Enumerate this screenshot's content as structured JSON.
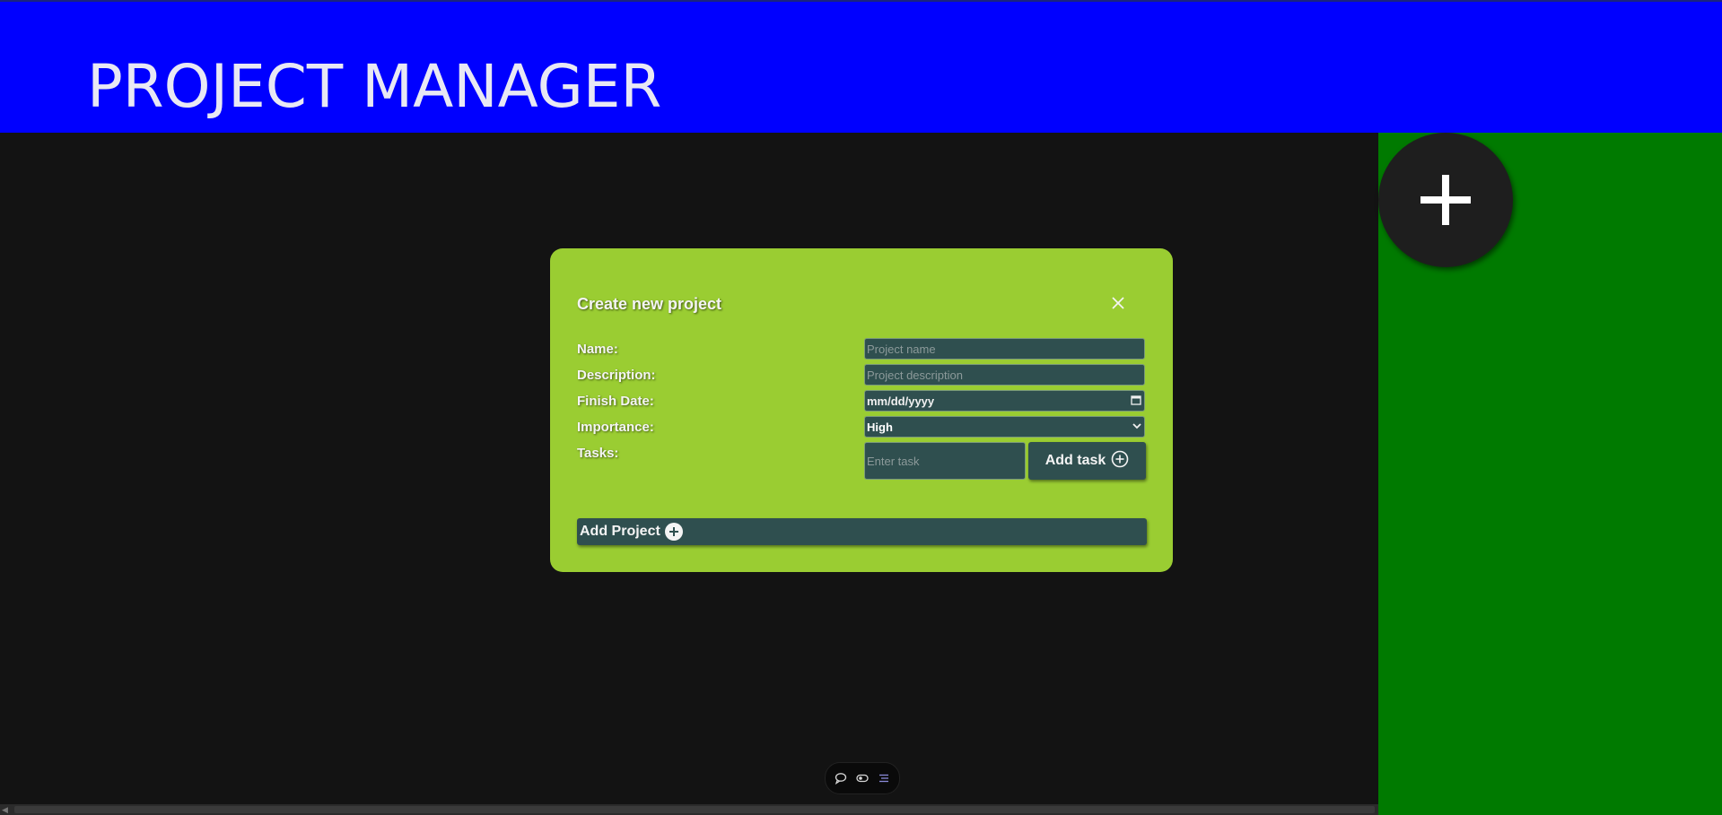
{
  "header": {
    "title": "PROJECT MANAGER"
  },
  "colors": {
    "header_bg": "#0000ff",
    "main_bg": "#131313",
    "sidebar_bg": "#007a00",
    "modal_bg": "#9acd32",
    "field_bg": "#2f4f4f"
  },
  "sidebar": {
    "add_button_icon": "plus-icon"
  },
  "modal": {
    "title": "Create new project",
    "close_icon": "close-icon",
    "fields": {
      "name": {
        "label": "Name:",
        "placeholder": "Project name",
        "value": ""
      },
      "description": {
        "label": "Description:",
        "placeholder": "Project description",
        "value": ""
      },
      "finish_date": {
        "label": "Finish Date:",
        "value": "mm/dd/yyyy",
        "icon": "calendar-icon"
      },
      "importance": {
        "label": "Importance:",
        "selected": "High",
        "icon": "chevron-down-icon"
      },
      "tasks": {
        "label": "Tasks:",
        "placeholder": "Enter task",
        "add_label": "Add task",
        "add_icon": "circle-plus-icon"
      }
    },
    "submit": {
      "label": "Add Project",
      "icon": "circle-plus-icon"
    }
  },
  "bottom_toolbar": {
    "icons": [
      "comment-icon",
      "toggle-icon",
      "list-icon"
    ]
  }
}
